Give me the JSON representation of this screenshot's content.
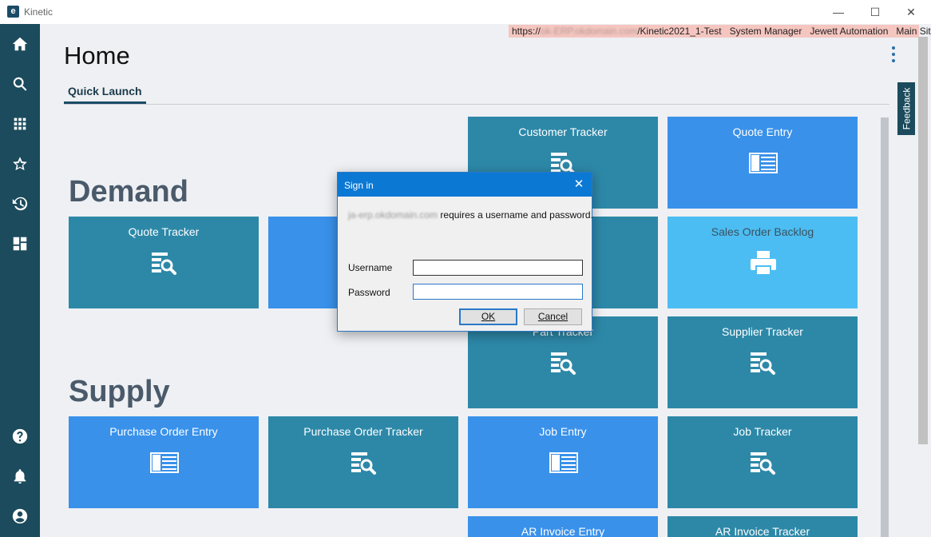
{
  "window": {
    "title": "Kinetic",
    "logo_letter": "e",
    "controls": {
      "minimize": "—",
      "maximize": "☐",
      "close": "✕"
    }
  },
  "nav_rail": {
    "items": [
      {
        "name": "home-icon"
      },
      {
        "name": "search-icon"
      },
      {
        "name": "apps-grid-icon"
      },
      {
        "name": "favorites-star-icon"
      },
      {
        "name": "history-icon"
      },
      {
        "name": "dashboard-icon"
      },
      {
        "name": "help-icon"
      },
      {
        "name": "notifications-bell-icon"
      },
      {
        "name": "user-account-icon"
      }
    ]
  },
  "info_strip": {
    "url_prefix": "https://",
    "url_blurred": "ok-ERP.okdomain.com",
    "url_suffix": "/Kinetic2021_1-Test",
    "user": "System Manager",
    "company": "Jewett Automation",
    "site": "Main Site"
  },
  "page": {
    "title": "Home",
    "tab": "Quick Launch",
    "feedback": "Feedback"
  },
  "sections": {
    "demand": "Demand",
    "supply": "Supply"
  },
  "tiles": [
    {
      "label": "Customer Tracker",
      "icon": "tracker-magnifier-icon",
      "color": "#2d88a8"
    },
    {
      "label": "Quote Entry",
      "icon": "entry-form-icon",
      "color": "#3991ea"
    },
    {
      "label": "Quote Tracker",
      "icon": "tracker-magnifier-icon",
      "color": "#2d88a8"
    },
    {
      "label": "Sales Order Backlog",
      "icon": "printer-icon",
      "color": "#4cbdf2"
    },
    {
      "label": "Part Tracker",
      "icon": "tracker-magnifier-icon",
      "color": "#2d88a8"
    },
    {
      "label": "Supplier Tracker",
      "icon": "tracker-magnifier-icon",
      "color": "#2d88a8"
    },
    {
      "label": "Purchase Order Entry",
      "icon": "entry-form-icon",
      "color": "#3991ea"
    },
    {
      "label": "Purchase Order Tracker",
      "icon": "tracker-magnifier-icon",
      "color": "#2d88a8"
    },
    {
      "label": "Job Entry",
      "icon": "entry-form-icon",
      "color": "#3991ea"
    },
    {
      "label": "Job Tracker",
      "icon": "tracker-magnifier-icon",
      "color": "#2d88a8"
    },
    {
      "label": "AR Invoice Entry",
      "icon": "entry-form-icon",
      "color": "#3991ea"
    },
    {
      "label": "AR Invoice Tracker",
      "icon": "tracker-magnifier-icon",
      "color": "#2d88a8"
    }
  ],
  "dialog": {
    "title": "Sign in",
    "host_blurred": "ja-erp.okdomain.com",
    "message": " requires a username and password.",
    "username_label": "Username",
    "username_value": "",
    "password_label": "Password",
    "password_value": "",
    "ok_label": "OK",
    "cancel_label": "Cancel"
  }
}
